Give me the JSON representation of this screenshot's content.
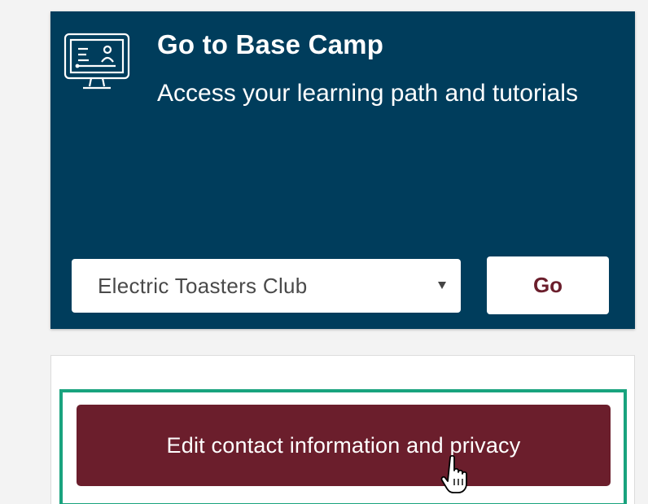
{
  "basecamp": {
    "title": "Go to Base Camp",
    "subtitle": "Access your learning path and tutorials",
    "icon": "monitor-icon",
    "club_select": {
      "selected": "Electric Toasters Club"
    },
    "go_label": "Go"
  },
  "profile": {
    "edit_contact_label": "Edit contact information and privacy"
  },
  "colors": {
    "card_background": "#003d5c",
    "accent_maroon": "#6b1e2c",
    "highlight_green": "#19a37e"
  }
}
